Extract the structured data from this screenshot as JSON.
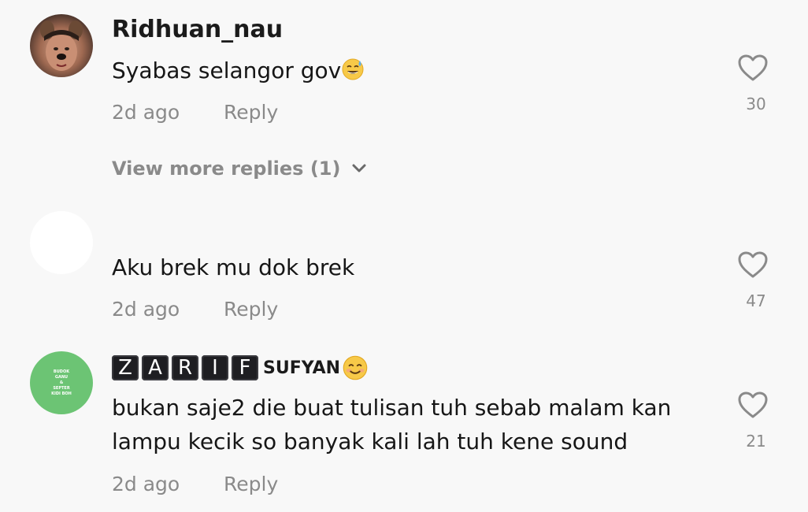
{
  "comments": [
    {
      "username": "Ridhuan_nau",
      "text": "Syabas selangor gov",
      "time": "2d ago",
      "reply_label": "Reply",
      "likes": "30",
      "view_more": "View more replies (1)",
      "emoji": "sweat-smile-emoji"
    },
    {
      "username": "",
      "text": "Aku brek mu dok brek",
      "time": "2d ago",
      "reply_label": "Reply",
      "likes": "47"
    },
    {
      "username_boxes": [
        "Z",
        "A",
        "R",
        "I",
        "F"
      ],
      "username_suffix": "SUFYAN",
      "text_line1": "bukan saje2 die buat tulisan tuh sebab malam kan",
      "text_line2": "lampu kecik so banyak kali lah tuh kene sound",
      "time": "2d ago",
      "reply_label": "Reply",
      "likes": "21",
      "avatar_text": [
        "BUDOK",
        "GANU",
        "&",
        "SEPTER",
        "KIDI BOH"
      ],
      "emoji": "smile-emoji"
    }
  ],
  "colors": {
    "background": "#f8f8f8",
    "text": "#161616",
    "muted": "#8a8a8a",
    "avatar_green": "#6cc474"
  }
}
